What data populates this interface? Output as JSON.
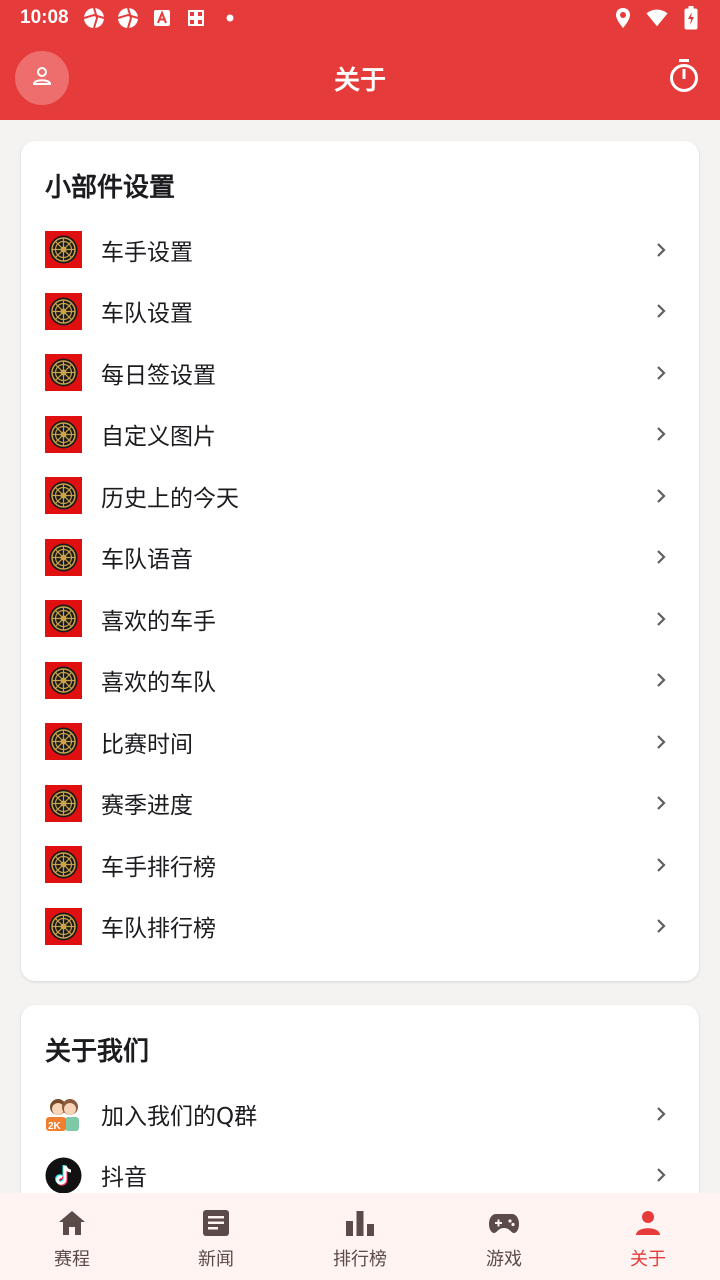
{
  "status_bar": {
    "time": "10:08",
    "left_icons": [
      "aperture-icon",
      "aperture-icon",
      "font-a-icon",
      "grid-icon",
      "dot-icon"
    ],
    "right_icons": [
      "location-icon",
      "wifi-icon",
      "battery-charging-icon"
    ]
  },
  "app_bar": {
    "title": "关于",
    "left_icon": "person-icon",
    "right_icon": "stopwatch-icon",
    "color": "#e63b3b"
  },
  "widget_settings": {
    "title": "小部件设置",
    "items": [
      {
        "label": "车手设置"
      },
      {
        "label": "车队设置"
      },
      {
        "label": "每日签设置"
      },
      {
        "label": "自定义图片"
      },
      {
        "label": "历史上的今天"
      },
      {
        "label": "车队语音"
      },
      {
        "label": "喜欢的车手"
      },
      {
        "label": "喜欢的车队"
      },
      {
        "label": "比赛时间"
      },
      {
        "label": "赛季进度"
      },
      {
        "label": "车手排行榜"
      },
      {
        "label": "车队排行榜"
      }
    ]
  },
  "about_us": {
    "title": "关于我们",
    "items": [
      {
        "label": "加入我们的Q群",
        "icon": "qq-group-icon"
      },
      {
        "label": "抖音",
        "icon": "tiktok-icon"
      }
    ]
  },
  "bottom_nav": {
    "items": [
      {
        "label": "赛程",
        "icon": "home-icon"
      },
      {
        "label": "新闻",
        "icon": "article-icon"
      },
      {
        "label": "排行榜",
        "icon": "bar-chart-icon"
      },
      {
        "label": "游戏",
        "icon": "gamepad-icon"
      },
      {
        "label": "关于",
        "icon": "person-icon",
        "active": true
      }
    ],
    "active_color": "#e63b3b"
  }
}
